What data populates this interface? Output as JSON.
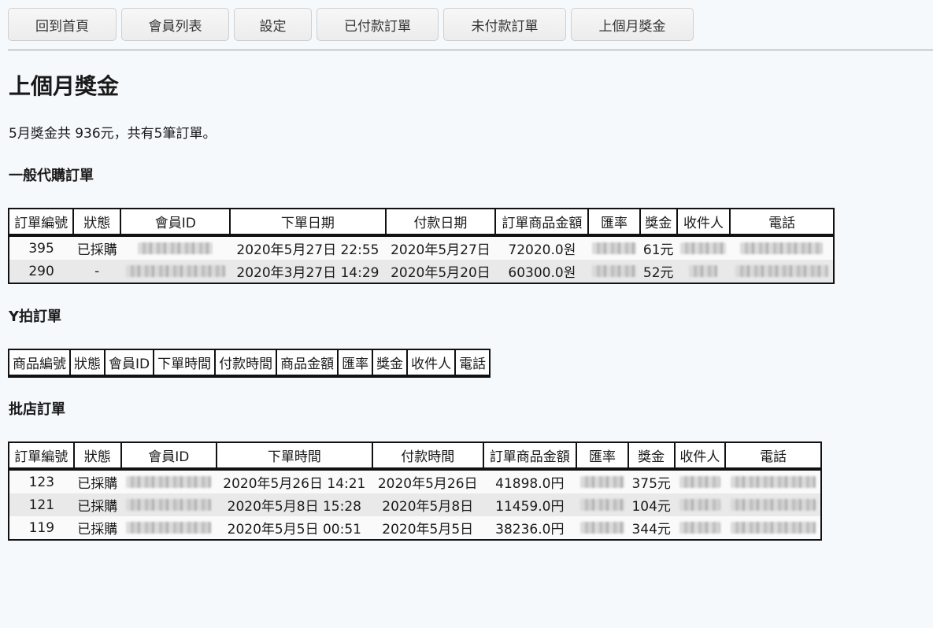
{
  "nav": {
    "buttons": [
      "回到首頁",
      "會員列表",
      "設定",
      "已付款訂單",
      "未付款訂單",
      "上個月獎金"
    ]
  },
  "page": {
    "title": "上個月獎金",
    "summary": "5月獎金共 936元，共有5筆訂單。"
  },
  "general_orders": {
    "title": "一般代購訂單",
    "headers": [
      "訂單編號",
      "狀態",
      "會員ID",
      "下單日期",
      "付款日期",
      "訂單商品金額",
      "匯率",
      "獎金",
      "收件人",
      "電話"
    ],
    "rows": [
      [
        "395",
        "已採購",
        "",
        "2020年5月27日 22:55",
        "2020年5月27日",
        "72020.0원",
        "",
        "61元",
        "",
        ""
      ],
      [
        "290",
        "-",
        "",
        "2020年3月27日 14:29",
        "2020年5月20日",
        "60300.0원",
        "",
        "52元",
        "",
        ""
      ]
    ]
  },
  "y_orders": {
    "title": "Y拍訂單",
    "headers": [
      "商品編號",
      "狀態",
      "會員ID",
      "下單時間",
      "付款時間",
      "商品金額",
      "匯率",
      "獎金",
      "收件人",
      "電話"
    ]
  },
  "batch_orders": {
    "title": "批店訂單",
    "headers": [
      "訂單編號",
      "狀態",
      "會員ID",
      "下單時間",
      "付款時間",
      "訂單商品金額",
      "匯率",
      "獎金",
      "收件人",
      "電話"
    ],
    "rows": [
      [
        "123",
        "已採購",
        "",
        "2020年5月26日 14:21",
        "2020年5月26日",
        "41898.0円",
        "",
        "375元",
        "",
        ""
      ],
      [
        "121",
        "已採購",
        "",
        "2020年5月8日 15:28",
        "2020年5月8日",
        "11459.0円",
        "",
        "104元",
        "",
        ""
      ],
      [
        "119",
        "已採購",
        "",
        "2020年5月5日 00:51",
        "2020年5月5日",
        "38236.0円",
        "",
        "344元",
        "",
        ""
      ]
    ]
  }
}
